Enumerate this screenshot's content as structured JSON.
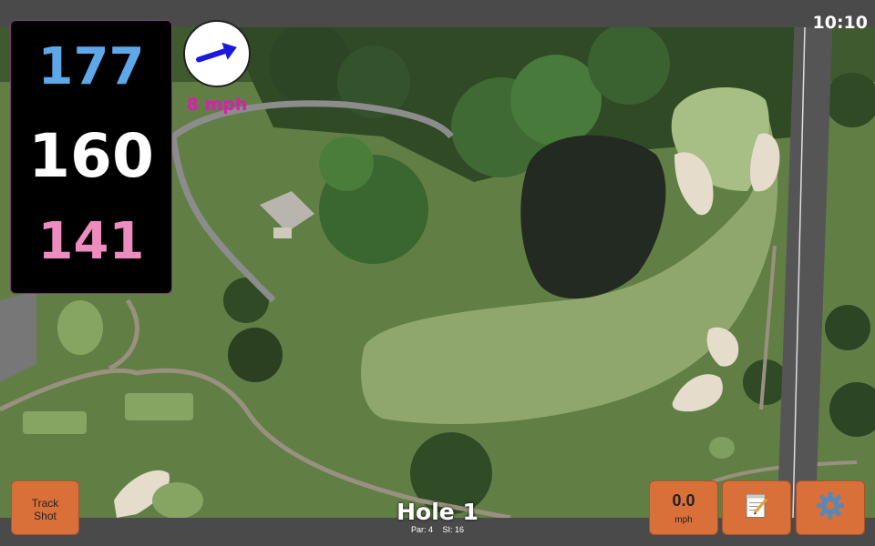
{
  "status_bar": {
    "clock": "10:10"
  },
  "distances": {
    "back": "177",
    "center": "160",
    "front": "141"
  },
  "wind": {
    "speed_label": "8 mph",
    "direction_icon": "arrow-right-icon"
  },
  "hole": {
    "title": "Hole 1",
    "par_label": "Par: 4",
    "si_label": "SI: 16"
  },
  "buttons": {
    "track_shot_line1": "Track",
    "track_shot_line2": "Shot",
    "speed_value": "0.0",
    "speed_unit": "mph",
    "notes_icon": "notepad-icon",
    "settings_icon": "gear-icon"
  },
  "colors": {
    "back_distance": "#5ea8ea",
    "center_distance": "#ffffff",
    "front_distance": "#ee8cc0",
    "wind_speed": "#d91fb0",
    "button_bg": "#d9703a",
    "bar_bg": "#4a4a4a"
  }
}
